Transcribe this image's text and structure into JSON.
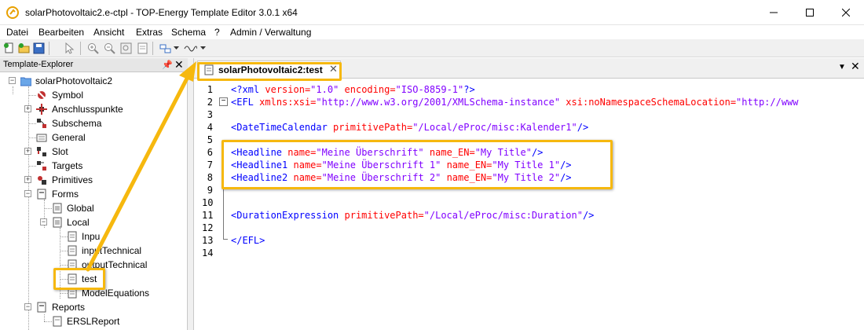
{
  "window": {
    "title": "solarPhotovoltaic2.e-ctpl - TOP-Energy Template Editor 3.0.1 x64",
    "minimize_icon": "minimize-icon",
    "maximize_icon": "maximize-icon",
    "close_icon": "close-icon"
  },
  "menu": {
    "items": [
      {
        "label": "Datei"
      },
      {
        "label": "Bearbeiten"
      },
      {
        "label": "Ansicht"
      },
      {
        "label": "Extras"
      },
      {
        "label": "Schema"
      },
      {
        "label": "?"
      },
      {
        "label": "Admin / Verwaltung"
      }
    ]
  },
  "toolbar": {
    "icons": [
      "new-file-icon",
      "open-folder-icon",
      "save-icon",
      "pointer-icon",
      "zoom-in-icon",
      "zoom-out-icon",
      "zoom-fit-icon",
      "zoom-page-icon",
      "layout-icon",
      "waveform-icon"
    ]
  },
  "explorer": {
    "title": "Template-Explorer",
    "root": "solarPhotovoltaic2",
    "nodes": {
      "symbol": "Symbol",
      "anschlusspunkte": "Anschlusspunkte",
      "subschema": "Subschema",
      "general": "General",
      "slot": "Slot",
      "targets": "Targets",
      "primitives": "Primitives",
      "forms": "Forms",
      "global": "Global",
      "local": "Local",
      "input": "Inpu",
      "inputtechnical": "inputTechnical",
      "outputtechnical": "outputTechnical",
      "test": "test",
      "modelequations": "ModelEquations",
      "reports": "Reports",
      "erslreport": "ERSLReport"
    }
  },
  "editor": {
    "tab_label": "solarPhotovoltaic2:test",
    "line_numbers": [
      "1",
      "2",
      "3",
      "4",
      "5",
      "6",
      "7",
      "8",
      "9",
      "10",
      "11",
      "12",
      "13",
      "14"
    ],
    "code": {
      "l1": {
        "open": "<?",
        "tag": "xml",
        "a1": " version=",
        "v1": "\"1.0\"",
        "a2": " encoding=",
        "v2": "\"ISO-8859-1\"",
        "close": "?>"
      },
      "l2": {
        "open": "<",
        "tag": "EFL",
        "a1": " xmlns:xsi=",
        "v1": "\"http://www.w3.org/2001/XMLSchema-instance\"",
        "a2": " xsi:noNamespaceSchemaLocation=",
        "v2": "\"http://www"
      },
      "l4": {
        "open": "<",
        "tag": "DateTimeCalendar",
        "a1": " primitivePath=",
        "v1": "\"/Local/eProc/misc:Kalender1\"",
        "close": "/>"
      },
      "l6": {
        "open": "<",
        "tag": "Headline",
        "a1": " name=",
        "v1": "\"Meine Überschrift\"",
        "a2": " name_EN=",
        "v2": "\"My Title\"",
        "close": "/>"
      },
      "l7": {
        "open": "<",
        "tag": "Headline1",
        "a1": " name=",
        "v1": "\"Meine Überschrift 1\"",
        "a2": " name_EN=",
        "v2": "\"My Title 1\"",
        "close": "/>"
      },
      "l8": {
        "open": "<",
        "tag": "Headline2",
        "a1": " name=",
        "v1": "\"Meine Überschrift 2\"",
        "a2": " name_EN=",
        "v2": "\"My Title 2\"",
        "close": "/>"
      },
      "l11": {
        "open": "<",
        "tag": "DurationExpression",
        "a1": " primitivePath=",
        "v1": "\"/Local/eProc/misc:Duration\"",
        "close": "/>"
      },
      "l13": {
        "open": "</",
        "tag": "EFL",
        "close": ">"
      }
    }
  },
  "colors": {
    "highlight": "#f6b80e",
    "tag": "#0000ff",
    "attribute": "#ff0000",
    "value": "#8000ff"
  }
}
